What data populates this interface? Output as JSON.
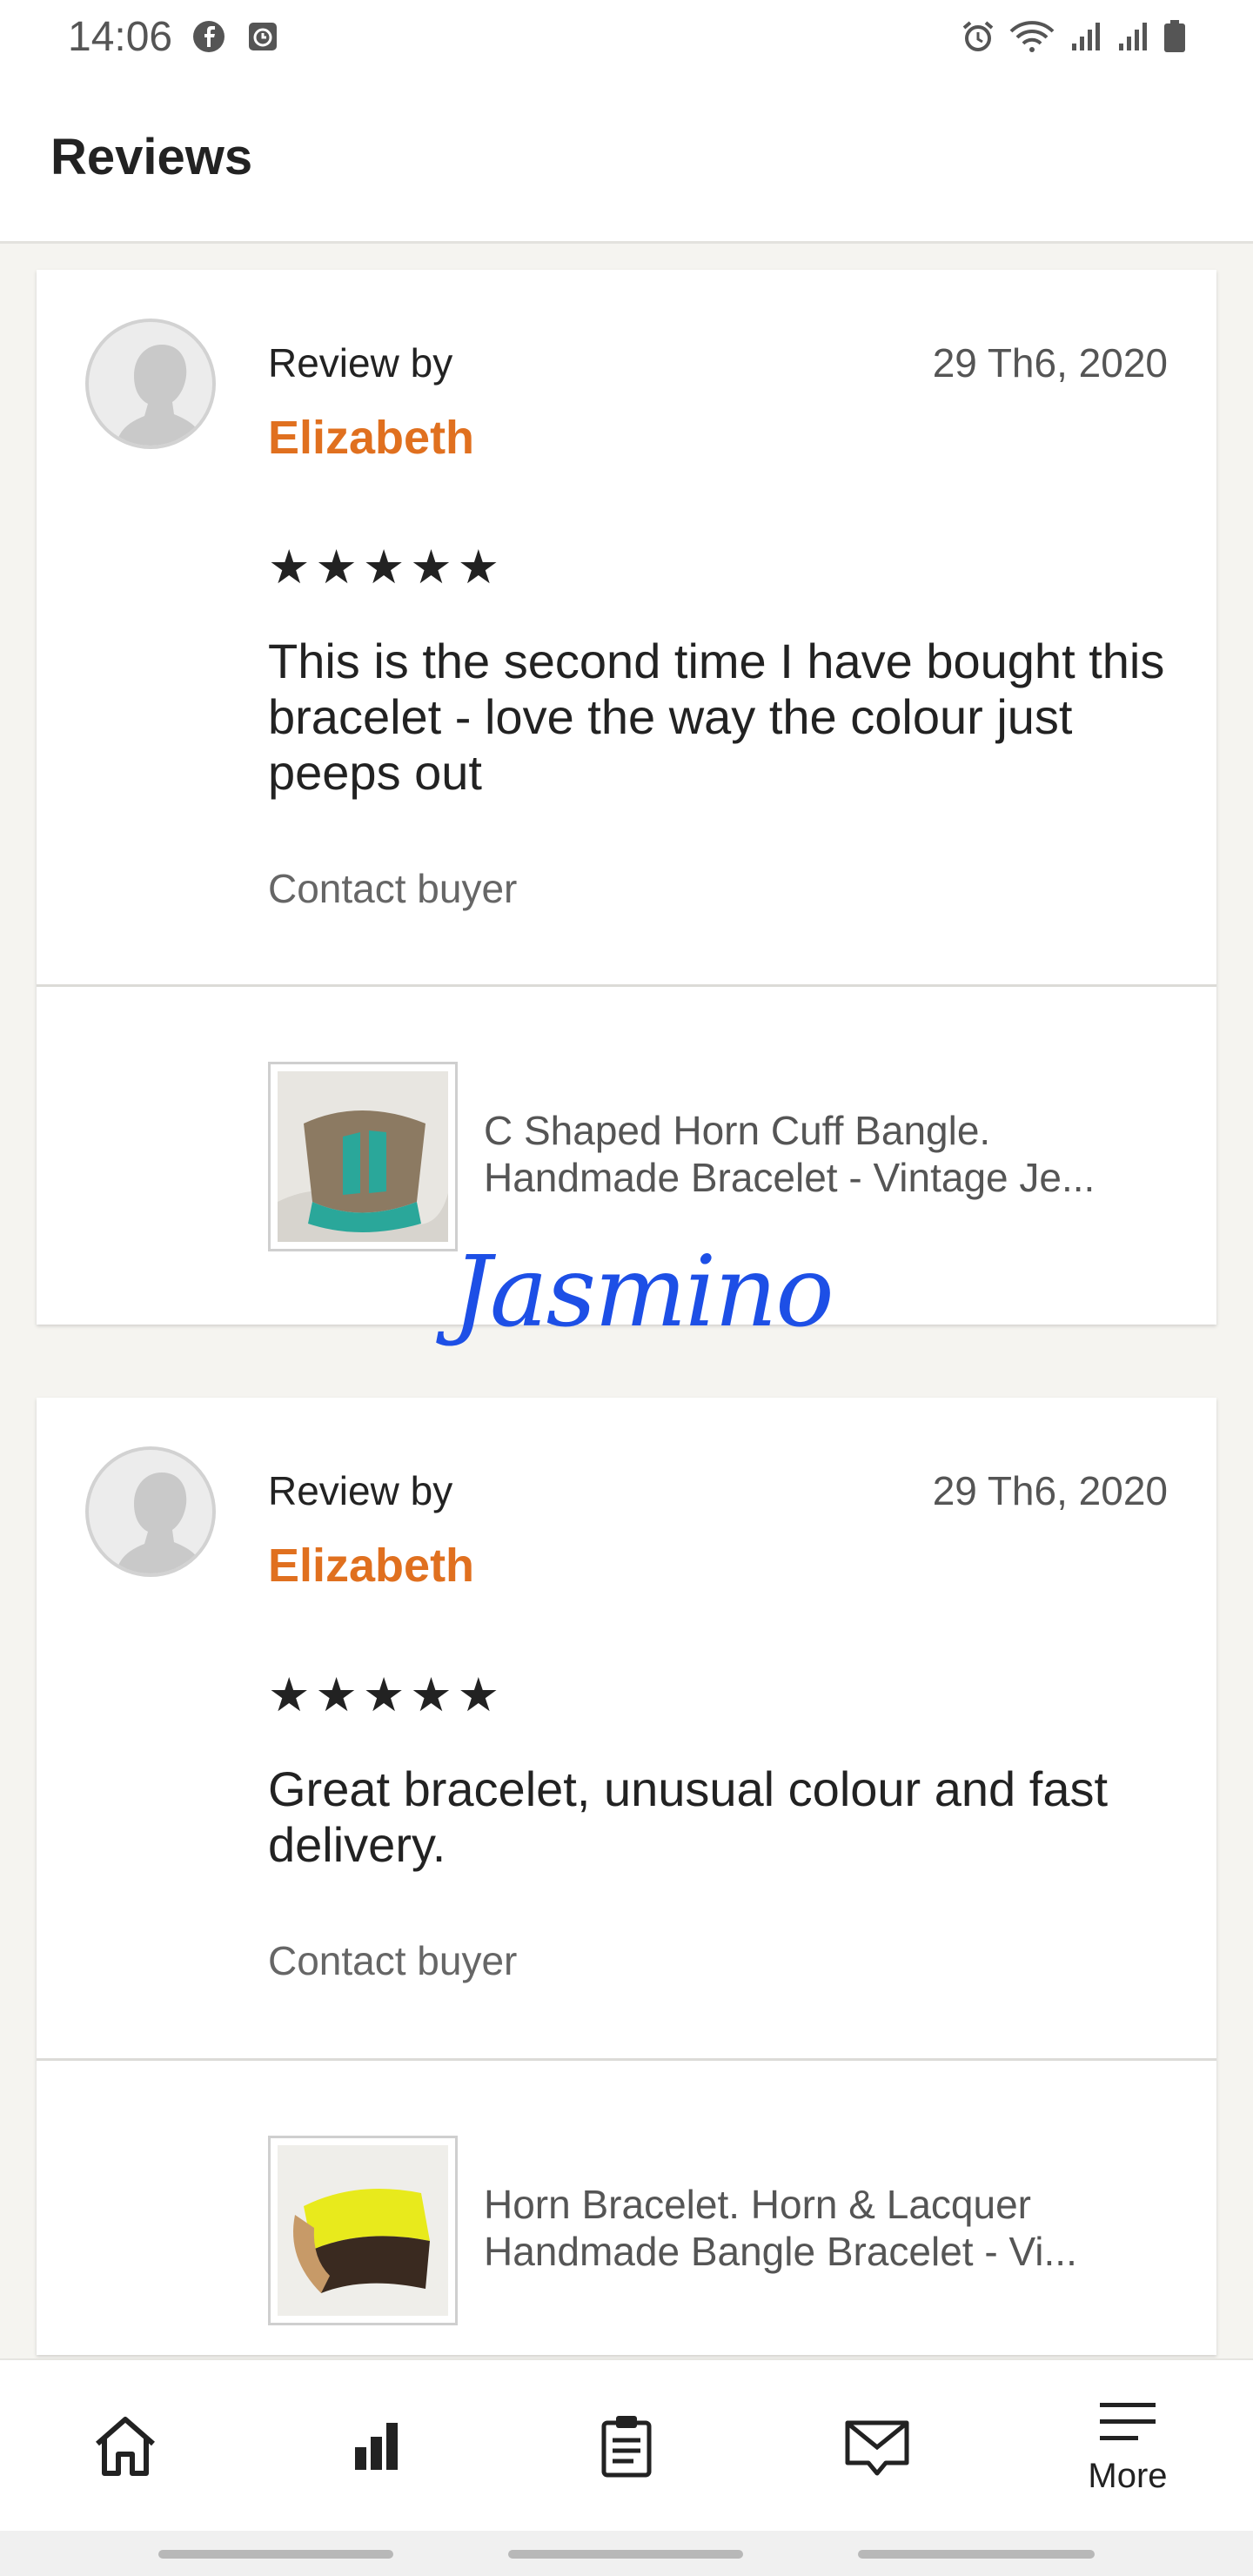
{
  "status_bar": {
    "time": "14:06",
    "icons_left": [
      "facebook-icon",
      "clock-app-icon"
    ],
    "icons_right": [
      "alarm-icon",
      "wifi-icon",
      "signal-icon",
      "signal-icon",
      "battery-icon"
    ]
  },
  "header": {
    "title": "Reviews"
  },
  "reviews": [
    {
      "by_label": "Review by",
      "name": "Elizabeth",
      "date": "29 Th6, 2020",
      "stars": "★★★★★",
      "rating": 5,
      "text": "This is the second time I have bought this bracelet - love the way the colour just peeps out",
      "contact_label": "Contact buyer",
      "listing": {
        "title_line1": "C Shaped Horn Cuff Bangle.",
        "title_line2": "Handmade Bracelet - Vintage Je..."
      }
    },
    {
      "by_label": "Review by",
      "name": "Elizabeth",
      "date": "29 Th6, 2020",
      "stars": "★★★★★",
      "rating": 5,
      "text": "Great bracelet, unusual colour and fast delivery.",
      "contact_label": "Contact buyer",
      "listing": {
        "title_line1": "Horn Bracelet. Horn & Lacquer",
        "title_line2": "Handmade Bangle Bracelet - Vi..."
      }
    }
  ],
  "watermark": "Jasmino",
  "bottom_nav": {
    "items": [
      {
        "icon": "home-icon"
      },
      {
        "icon": "stats-icon"
      },
      {
        "icon": "orders-icon"
      },
      {
        "icon": "messages-icon"
      },
      {
        "icon": "menu-icon",
        "label": "More"
      }
    ]
  },
  "colors": {
    "accent": "#e0701f",
    "watermark": "#1d4fe6"
  }
}
